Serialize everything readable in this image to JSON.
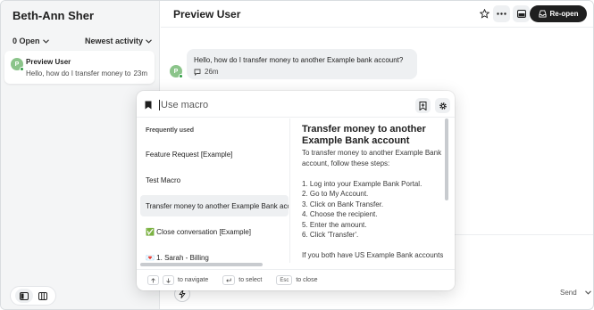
{
  "sidebar": {
    "title": "Beth-Ann Sher",
    "filter_status": "0 Open",
    "filter_sort": "Newest activity",
    "conversation": {
      "avatar_letter": "P",
      "name": "Preview User",
      "preview": "Hello, how do I transfer money to another Example bank account?",
      "time": "23m"
    }
  },
  "header": {
    "title": "Preview User",
    "reopen_label": "Re-open"
  },
  "message": {
    "avatar_letter": "P",
    "text": "Hello, how do I transfer money to another Example bank account?",
    "time": "26m"
  },
  "composer": {
    "send_label": "Send"
  },
  "macro": {
    "placeholder": "Use macro",
    "section_label": "Frequently used",
    "items": [
      {
        "label": "Feature Request [Example]"
      },
      {
        "label": "Test Macro"
      },
      {
        "label": "Transfer money to another Example Bank account"
      },
      {
        "label": "✅ Close conversation [Example]"
      },
      {
        "label": "💌 1. Sarah - Billing"
      }
    ],
    "preview": {
      "title": "Transfer money to another Example Bank account",
      "intro": "To transfer money to another Example Bank account, follow these steps:",
      "steps": [
        "1. Log into your Example Bank Portal.",
        "2. Go to My Account.",
        "3. Click on Bank Transfer.",
        "4. Choose the recipient.",
        "5. Enter the amount.",
        "6. Click 'Transfer'."
      ],
      "outro": "If you both have US Example Bank accounts and have added each other to"
    },
    "footer": {
      "navigate_label": "to navigate",
      "select_label": "to select",
      "esc_key": "Esc",
      "close_label": "to close"
    }
  }
}
